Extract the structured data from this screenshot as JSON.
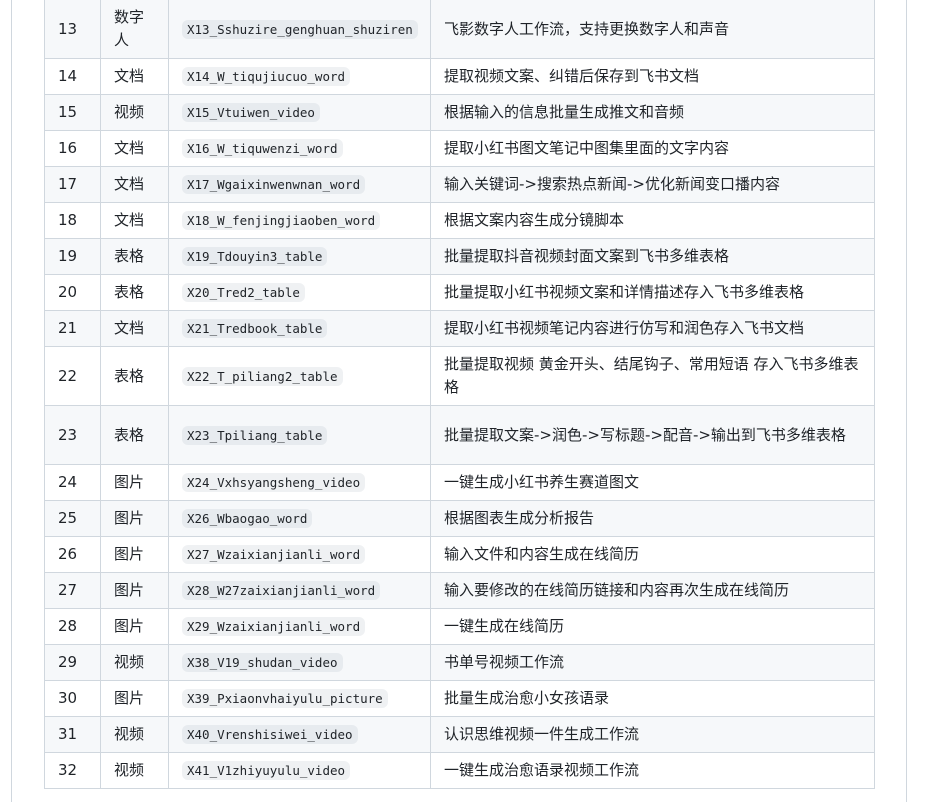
{
  "table": {
    "rows": [
      {
        "num": "13",
        "type": "数字人",
        "id": "X13_Sshuzire_genghuan_shuziren",
        "desc": "飞影数字人工作流，支持更换数字人和声音"
      },
      {
        "num": "14",
        "type": "文档",
        "id": "X14_W_tiqujiucuo_word",
        "desc": "提取视频文案、纠错后保存到飞书文档"
      },
      {
        "num": "15",
        "type": "视频",
        "id": "X15_Vtuiwen_video",
        "desc": "根据输入的信息批量生成推文和音频"
      },
      {
        "num": "16",
        "type": "文档",
        "id": "X16_W_tiquwenzi_word",
        "desc": "提取小红书图文笔记中图集里面的文字内容"
      },
      {
        "num": "17",
        "type": "文档",
        "id": "X17_Wgaixinwenwnan_word",
        "desc": "输入关键词->搜索热点新闻->优化新闻变口播内容"
      },
      {
        "num": "18",
        "type": "文档",
        "id": "X18_W_fenjingjiaoben_word",
        "desc": "根据文案内容生成分镜脚本"
      },
      {
        "num": "19",
        "type": "表格",
        "id": "X19_Tdouyin3_table",
        "desc": "批量提取抖音视频封面文案到飞书多维表格"
      },
      {
        "num": "20",
        "type": "表格",
        "id": "X20_Tred2_table",
        "desc": "批量提取小红书视频文案和详情描述存入飞书多维表格"
      },
      {
        "num": "21",
        "type": "文档",
        "id": "X21_Tredbook_table",
        "desc": "提取小红书视频笔记内容进行仿写和润色存入飞书文档"
      },
      {
        "num": "22",
        "type": "表格",
        "id": "X22_T_piliang2_table",
        "desc": "批量提取视频 黄金开头、结尾钩子、常用短语 存入飞书多维表格"
      },
      {
        "num": "23",
        "type": "表格",
        "id": "X23_Tpiliang_table",
        "desc": "批量提取文案->润色->写标题->配音->输出到飞书多维表格"
      },
      {
        "num": "24",
        "type": "图片",
        "id": "X24_Vxhsyangsheng_video",
        "desc": "一键生成小红书养生赛道图文"
      },
      {
        "num": "25",
        "type": "图片",
        "id": "X26_Wbaogao_word",
        "desc": "根据图表生成分析报告"
      },
      {
        "num": "26",
        "type": "图片",
        "id": "X27_Wzaixianjianli_word",
        "desc": "输入文件和内容生成在线简历"
      },
      {
        "num": "27",
        "type": "图片",
        "id": "X28_W27zaixianjianli_word",
        "desc": "输入要修改的在线简历链接和内容再次生成在线简历"
      },
      {
        "num": "28",
        "type": "图片",
        "id": "X29_Wzaixianjianli_word",
        "desc": "一键生成在线简历"
      },
      {
        "num": "29",
        "type": "视频",
        "id": "X38_V19_shudan_video",
        "desc": "书单号视频工作流"
      },
      {
        "num": "30",
        "type": "图片",
        "id": "X39_Pxiaonvhaiyulu_picture",
        "desc": "批量生成治愈小女孩语录"
      },
      {
        "num": "31",
        "type": "视频",
        "id": "X40_Vrenshisiwei_video",
        "desc": "认识思维视频一件生成工作流"
      },
      {
        "num": "32",
        "type": "视频",
        "id": "X41_V1zhiyuyulu_video",
        "desc": "一键生成治愈语录视频工作流"
      }
    ]
  }
}
